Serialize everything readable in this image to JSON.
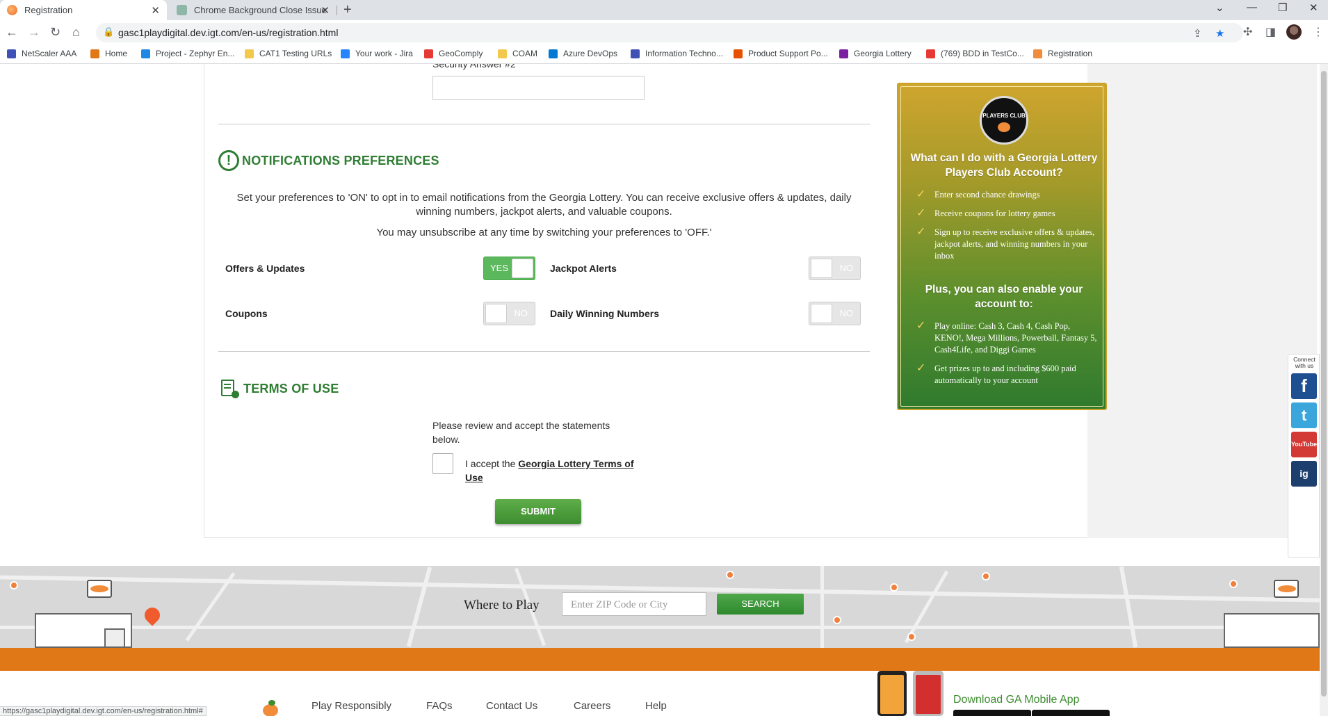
{
  "browser": {
    "tabs": [
      {
        "title": "Registration",
        "active": true
      },
      {
        "title": "Chrome Background Close Issue",
        "active": false
      }
    ],
    "url": "gasc1playdigital.dev.igt.com/en-us/registration.html",
    "bookmarks": [
      {
        "label": "NetScaler AAA",
        "icon": "netscaler-icon",
        "color": "#3f51b5"
      },
      {
        "label": "Home",
        "icon": "home-logo-icon",
        "color": "#e07818"
      },
      {
        "label": "Project - Zephyr En...",
        "icon": "zephyr-icon",
        "color": "#1e88e5"
      },
      {
        "label": "CAT1 Testing URLs",
        "icon": "folder-icon",
        "color": "#f2c94c"
      },
      {
        "label": "Your work - Jira",
        "icon": "jira-icon",
        "color": "#2684ff"
      },
      {
        "label": "GeoComply",
        "icon": "geocomply-icon",
        "color": "#e53935"
      },
      {
        "label": "COAM",
        "icon": "folder-icon",
        "color": "#f2c94c"
      },
      {
        "label": "Azure DevOps",
        "icon": "azure-devops-icon",
        "color": "#0078d4"
      },
      {
        "label": "Information Techno...",
        "icon": "it-icon",
        "color": "#3f51b5"
      },
      {
        "label": "Product Support Po...",
        "icon": "product-support-icon",
        "color": "#e65100"
      },
      {
        "label": "Georgia Lottery",
        "icon": "georgia-lottery-icon",
        "color": "#7b1fa2"
      },
      {
        "label": "(769) BDD in TestCo...",
        "icon": "youtube-icon",
        "color": "#e53935"
      },
      {
        "label": "Registration",
        "icon": "peach-icon",
        "color": "#f08c3a"
      }
    ],
    "status_url": "https://gasc1playdigital.dev.igt.com/en-us/registration.html#"
  },
  "form": {
    "security_answer_label": "Security Answer #2"
  },
  "notifications": {
    "title": "NOTIFICATIONS PREFERENCES",
    "description": "Set your preferences to 'ON' to opt in to email notifications from the Georgia Lottery. You can receive exclusive offers & updates, daily winning numbers, jackpot alerts, and valuable coupons.",
    "unsubscribe_note": "You may unsubscribe at any time by switching your preferences to 'OFF.'",
    "prefs": [
      {
        "label": "Offers & Updates",
        "state": "YES"
      },
      {
        "label": "Jackpot Alerts",
        "state": "NO"
      },
      {
        "label": "Coupons",
        "state": "NO"
      },
      {
        "label": "Daily Winning Numbers",
        "state": "NO"
      }
    ]
  },
  "terms": {
    "title": "TERMS OF USE",
    "review_text": "Please review and accept the statements below.",
    "accept_prefix": "I accept the ",
    "accept_link": "Georgia Lottery Terms of Use",
    "submit_label": "SUBMIT"
  },
  "promo": {
    "logo_text": "PLAYERS CLUB",
    "heading": "What can I do with a Georgia Lottery Players Club Account?",
    "items": [
      "Enter second chance drawings",
      "Receive coupons for lottery games",
      "Sign up to receive exclusive offers & updates, jackpot alerts, and winning numbers in your inbox"
    ],
    "subheading": "Plus, you can also enable your account to:",
    "items2": [
      "Play online: Cash 3, Cash 4, Cash Pop, KENO!, Mega Millions, Powerball, Fantasy 5, Cash4Life, and Diggi Games",
      "Get prizes up to and including $600 paid automatically to your account"
    ]
  },
  "social": {
    "label": "Connect with us",
    "items": [
      "f",
      "t",
      "YouTube",
      "ig"
    ]
  },
  "where_to_play": {
    "title": "Where to Play",
    "placeholder": "Enter ZIP Code or City",
    "search_label": "SEARCH"
  },
  "footer": {
    "links": [
      "Play Responsibly",
      "FAQs",
      "Contact Us",
      "Careers",
      "Help"
    ],
    "download_label": "Download GA Mobile App"
  }
}
